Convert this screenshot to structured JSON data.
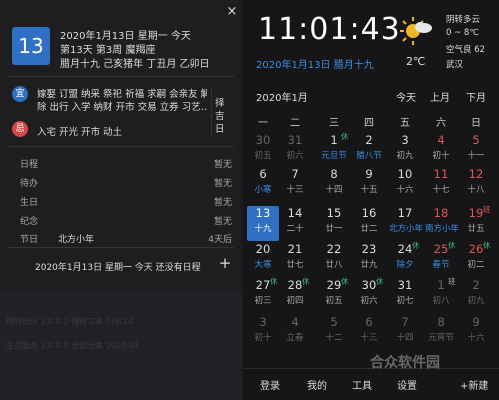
{
  "left": {
    "close_label": "×",
    "day_number": "13",
    "date_line": "2020年1月13日 星期一 今天",
    "week_line": "第13天 第3周 魔羯座",
    "ganzhi_line": "腊月十九 己亥猪年 丁丑月 乙卯日",
    "yi_label": "宜",
    "yi_line1": "嫁娶 订盟 纳采 祭祀 祈福 求嗣 会亲友 解",
    "yi_line2": "除 出行 入学 纳财 开市 交易 立券 习艺…",
    "ji_label": "忌",
    "ji_text": "入宅 开光 开市 动土",
    "jiri_chars": [
      "择",
      "吉",
      "日"
    ],
    "schedule": [
      {
        "label": "日程",
        "value": "暂无"
      },
      {
        "label": "待办",
        "value": "暂无"
      },
      {
        "label": "生日",
        "value": "暂无"
      },
      {
        "label": "纪念",
        "value": "暂无"
      },
      {
        "label": "节日",
        "value": "4天后"
      }
    ],
    "holiday_name": "北方小年",
    "no_schedule": "2020年1月13日 星期一 今天 还没有日程",
    "add_label": "+",
    "ghost_row1": "理财统计  1.0.0.2     理财工具        CHC14",
    "ghost_row2": "生活服务  1.0.0.9     全部分类        2020-01"
  },
  "header": {
    "time": "11:01:43",
    "date_line": "2020年1月13日 腊月十九",
    "temperature": "2℃",
    "weather_desc": "阴转多云",
    "temp_range": "0 ~ 8℃",
    "aqi": "空气良 62",
    "city": "武汉"
  },
  "calendar": {
    "month_label": "2020年1月",
    "nav_today": "今天",
    "nav_prev": "上月",
    "nav_next": "下月",
    "weekdays": [
      "一",
      "二",
      "三",
      "四",
      "五",
      "六",
      "日"
    ],
    "weeks": [
      [
        {
          "d": "30",
          "l": "初五",
          "dim": true
        },
        {
          "d": "31",
          "l": "初六",
          "dim": true
        },
        {
          "d": "1",
          "l": "元旦节",
          "badge": "休",
          "badgeType": "rest",
          "blue": true
        },
        {
          "d": "2",
          "l": "腊八节",
          "blue": true
        },
        {
          "d": "3",
          "l": "初九"
        },
        {
          "d": "4",
          "l": "初十",
          "we": true
        },
        {
          "d": "5",
          "l": "十一",
          "we": true
        }
      ],
      [
        {
          "d": "6",
          "l": "小寒",
          "blue": true
        },
        {
          "d": "7",
          "l": "十三"
        },
        {
          "d": "8",
          "l": "十四"
        },
        {
          "d": "9",
          "l": "十五"
        },
        {
          "d": "10",
          "l": "十六"
        },
        {
          "d": "11",
          "l": "十七",
          "we": true
        },
        {
          "d": "12",
          "l": "十八",
          "we": true
        }
      ],
      [
        {
          "d": "13",
          "l": "十九",
          "today": true
        },
        {
          "d": "14",
          "l": "二十"
        },
        {
          "d": "15",
          "l": "廿一"
        },
        {
          "d": "16",
          "l": "廿二"
        },
        {
          "d": "17",
          "l": "北方小年",
          "blue": true
        },
        {
          "d": "18",
          "l": "南方小年",
          "we": true,
          "blue": true
        },
        {
          "d": "19",
          "l": "廿五",
          "we": true,
          "badge": "班",
          "badgeType": "red"
        }
      ],
      [
        {
          "d": "20",
          "l": "大寒",
          "blue": true
        },
        {
          "d": "21",
          "l": "廿七"
        },
        {
          "d": "22",
          "l": "廿八"
        },
        {
          "d": "23",
          "l": "廿九"
        },
        {
          "d": "24",
          "l": "除夕",
          "badge": "休",
          "badgeType": "rest",
          "blue": true
        },
        {
          "d": "25",
          "l": "春节",
          "we": true,
          "badge": "休",
          "badgeType": "rest",
          "blue": true
        },
        {
          "d": "26",
          "l": "初二",
          "we": true,
          "badge": "休",
          "badgeType": "rest"
        }
      ],
      [
        {
          "d": "27",
          "l": "初三",
          "badge": "休",
          "badgeType": "rest"
        },
        {
          "d": "28",
          "l": "初四",
          "badge": "休",
          "badgeType": "rest"
        },
        {
          "d": "29",
          "l": "初五",
          "badge": "休",
          "badgeType": "rest"
        },
        {
          "d": "30",
          "l": "初六",
          "badge": "休",
          "badgeType": "rest"
        },
        {
          "d": "31",
          "l": "初七"
        },
        {
          "d": "1",
          "l": "初八",
          "dim": true,
          "badge": "班",
          "badgeType": "work"
        },
        {
          "d": "2",
          "l": "初九",
          "dim": true
        }
      ],
      [
        {
          "d": "3",
          "l": "初十",
          "dim": true
        },
        {
          "d": "4",
          "l": "立春",
          "dim": true
        },
        {
          "d": "5",
          "l": "十二",
          "dim": true
        },
        {
          "d": "6",
          "l": "十三",
          "dim": true
        },
        {
          "d": "7",
          "l": "十四",
          "dim": true
        },
        {
          "d": "8",
          "l": "元宵节",
          "dim": true
        },
        {
          "d": "9",
          "l": "十六",
          "dim": true
        }
      ]
    ]
  },
  "bottom": {
    "login": "登录",
    "mine": "我的",
    "tools": "工具",
    "settings": "设置",
    "add": "+新建"
  },
  "watermark": "合众软件园",
  "colors": {
    "accent": "#2f6fc4",
    "link": "#3a8ee6",
    "weekend": "#e05656",
    "rest": "#3bbf6f"
  }
}
